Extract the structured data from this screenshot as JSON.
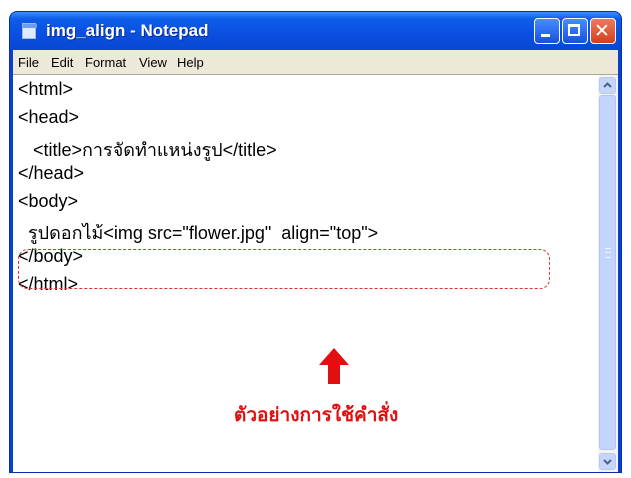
{
  "window": {
    "title": "img_align - Notepad",
    "buttons": {
      "minimize": "minimize",
      "maximize": "maximize",
      "close": "✕"
    }
  },
  "menu": {
    "items": [
      "File",
      "Edit",
      "Format",
      "View",
      "Help"
    ]
  },
  "editor": {
    "lines": [
      "<html>",
      "<head>",
      "   <title>การจัดทำแหน่งรูป</title>",
      "</head>",
      "<body>",
      "  รูปดอกไม้<img src=\"flower.jpg\"  align=\"top\">",
      "</body>",
      "</html>"
    ]
  },
  "annotation": {
    "caption": "ตัวอย่างการใช้คำสั่ง",
    "color": "#e01010"
  },
  "colors": {
    "titlebar": "#0a4fe0",
    "menubar": "#ece9d8",
    "highlight": "#e03030"
  }
}
